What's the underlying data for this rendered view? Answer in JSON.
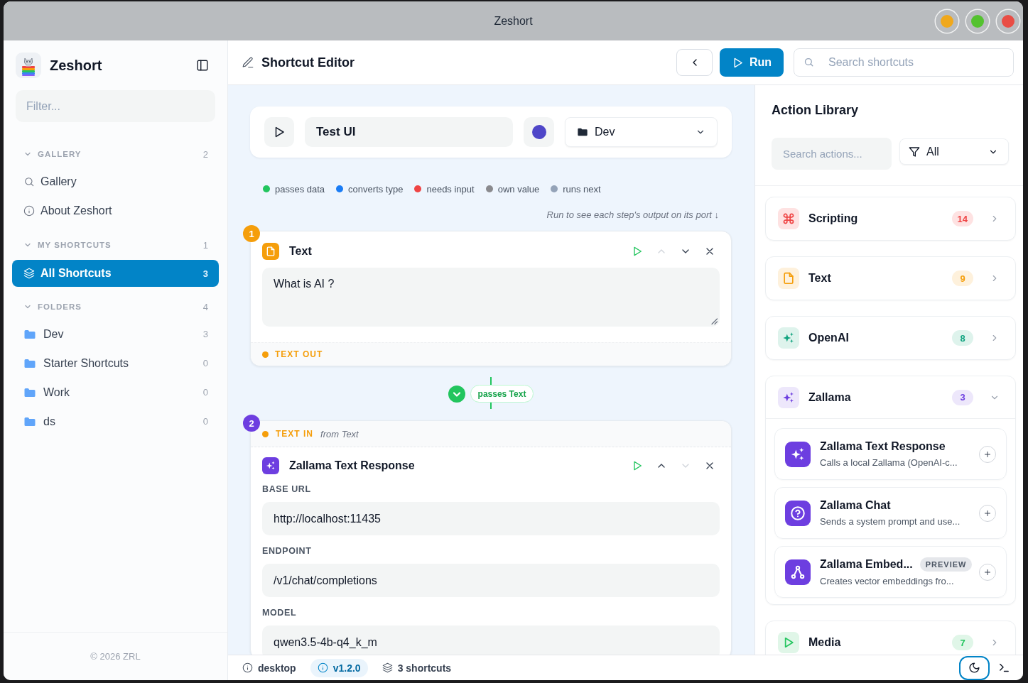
{
  "window": {
    "title": "Zeshort",
    "controls": [
      {
        "color": "#f0a81c"
      },
      {
        "color": "#54c22f"
      },
      {
        "color": "#e94d45"
      }
    ]
  },
  "sidebar": {
    "app_name": "Zeshort",
    "filter": {
      "placeholder": "Filter..."
    },
    "sections": [
      {
        "title": "GALLERY",
        "count": "2",
        "expanded": true,
        "items": [
          {
            "kind": "search",
            "label": "Gallery",
            "selected": false
          },
          {
            "kind": "info",
            "label": "About Zeshort",
            "selected": false
          }
        ]
      },
      {
        "title": "MY SHORTCUTS",
        "count": "1",
        "expanded": true,
        "items": [
          {
            "kind": "layers",
            "label": "All Shortcuts",
            "count": "3",
            "selected": true
          }
        ]
      },
      {
        "title": "FOLDERS",
        "count": "4",
        "expanded": true,
        "items": [
          {
            "kind": "folder",
            "label": "Dev",
            "count": "3",
            "selected": false
          },
          {
            "kind": "folder",
            "label": "Starter Shortcuts",
            "count": "0",
            "selected": false
          },
          {
            "kind": "folder",
            "label": "Work",
            "count": "0",
            "selected": false
          },
          {
            "kind": "folder",
            "label": "ds",
            "count": "0",
            "selected": false
          }
        ]
      }
    ],
    "footer": "© 2026 ZRL"
  },
  "header": {
    "title": "Shortcut Editor",
    "run_label": "Run",
    "search": {
      "placeholder": "Search shortcuts"
    }
  },
  "editor": {
    "shortcut": {
      "name": "Test UI",
      "color": "#4f46c8",
      "folder": "Dev"
    },
    "legend": [
      {
        "label": "passes data",
        "color": "#22c55e"
      },
      {
        "label": "converts type",
        "color": "#1a7cf5"
      },
      {
        "label": "needs input",
        "color": "#ef4444"
      },
      {
        "label": "own value",
        "color": "#8a8a8e"
      },
      {
        "label": "runs next",
        "color": "#94a3b8"
      }
    ],
    "hint": "Run to see each step's output on its port ↓",
    "steps": [
      {
        "number": "1",
        "kind": "text",
        "title": "Text",
        "up_disabled": true,
        "down_disabled": false,
        "text": "What is AI ?",
        "output": "TEXT OUT"
      },
      {
        "number": "2",
        "kind": "zallama",
        "input": "TEXT IN",
        "input_source": "from Text",
        "title": "Zallama Text Response",
        "up_disabled": false,
        "down_disabled": true,
        "fields": [
          {
            "label": "BASE URL",
            "value": "http://localhost:11435"
          },
          {
            "label": "ENDPOINT",
            "value": "/v1/chat/completions"
          },
          {
            "label": "MODEL",
            "value": "qwen3.5-4b-q4_k_m"
          }
        ]
      }
    ],
    "connectors": [
      {
        "label": "passes Text"
      }
    ]
  },
  "library": {
    "title": "Action Library",
    "search": {
      "placeholder": "Search actions..."
    },
    "filter": "All",
    "categories": [
      {
        "kind": "scripting",
        "name": "Scripting",
        "count": "14",
        "expanded": false
      },
      {
        "kind": "text",
        "name": "Text",
        "count": "9",
        "expanded": false
      },
      {
        "kind": "openai",
        "name": "OpenAI",
        "count": "8",
        "expanded": false
      },
      {
        "kind": "zallama",
        "name": "Zallama",
        "count": "3",
        "expanded": true,
        "actions": [
          {
            "kind": "sparkles",
            "name": "Zallama Text Response",
            "description": "Calls a local Zallama (OpenAI-c..."
          },
          {
            "kind": "help",
            "name": "Zallama Chat",
            "description": "Sends a system prompt and use..."
          },
          {
            "kind": "fork",
            "name": "Zallama Embed...",
            "tag": "PREVIEW",
            "description": "Creates vector embeddings fro..."
          }
        ]
      },
      {
        "kind": "media",
        "name": "Media",
        "count": "7",
        "expanded": false
      }
    ]
  },
  "status_bar": {
    "items": [
      {
        "kind": "info",
        "label": "desktop",
        "highlighted": false
      },
      {
        "kind": "info",
        "label": "v1.2.0",
        "highlighted": true
      },
      {
        "kind": "layers",
        "label": "3 shortcuts",
        "highlighted": false
      }
    ],
    "theme_button": {
      "focused": true
    }
  }
}
